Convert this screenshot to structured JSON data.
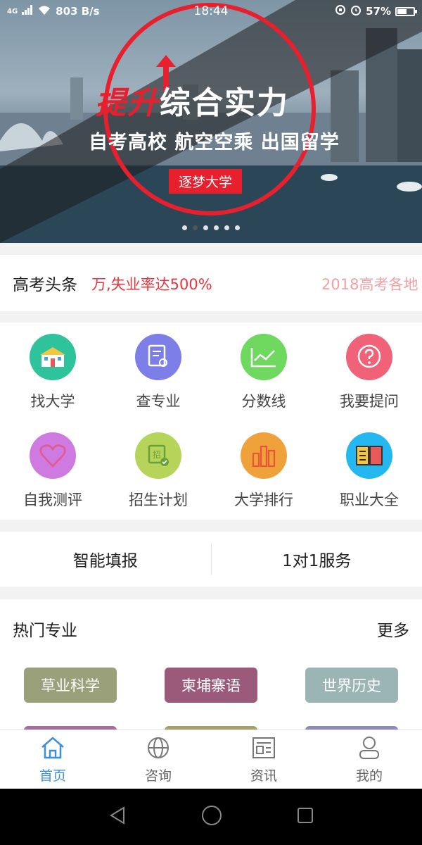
{
  "status_bar": {
    "network": "4G",
    "speed": "803 B/s",
    "time": "18:44",
    "battery": "57%",
    "battery_level": 0.57
  },
  "banner": {
    "headline_red": "提升",
    "headline_white": "综合实力",
    "subline": "自考高校 航空空乘 出国留学",
    "tag": "逐梦大学",
    "slide_count": 6,
    "active_slide": 2
  },
  "ticker": {
    "label": "高考头条",
    "items": [
      "万,失业率达500%",
      "2018高考各地"
    ]
  },
  "grid": [
    {
      "label": "找大学",
      "color": "#2ec39a",
      "icon": "school-icon"
    },
    {
      "label": "查专业",
      "color": "#7d7ee8",
      "icon": "certificate-icon"
    },
    {
      "label": "分数线",
      "color": "#6fd85f",
      "icon": "line-chart-icon"
    },
    {
      "label": "我要提问",
      "color": "#f06277",
      "icon": "question-bubble-icon"
    },
    {
      "label": "自我测评",
      "color": "#cf7ae0",
      "icon": "heart-icon"
    },
    {
      "label": "招生计划",
      "color": "#b6d45a",
      "icon": "enrollment-stamp-icon"
    },
    {
      "label": "大学排行",
      "color": "#f0a23a",
      "icon": "bar-chart-icon"
    },
    {
      "label": "职业大全",
      "color": "#25b8f0",
      "icon": "book-icon"
    }
  ],
  "service": {
    "smart_fill": "智能填报",
    "one_on_one": "1对1服务"
  },
  "hot_majors": {
    "title": "热门专业",
    "more": "更多",
    "items": [
      {
        "label": "草业科学",
        "color": "#9aa07a"
      },
      {
        "label": "柬埔寨语",
        "color": "#9b5a7a"
      },
      {
        "label": "世界历史",
        "color": "#9bb5b5"
      }
    ],
    "partial_colors": [
      "#a36e9e",
      "#a3a06a",
      "#8d8ab8"
    ]
  },
  "tabbar": [
    {
      "label": "首页",
      "icon": "home-icon",
      "active": true
    },
    {
      "label": "咨询",
      "icon": "globe-icon",
      "active": false
    },
    {
      "label": "资讯",
      "icon": "news-icon",
      "active": false
    },
    {
      "label": "我的",
      "icon": "user-icon",
      "active": false
    }
  ]
}
